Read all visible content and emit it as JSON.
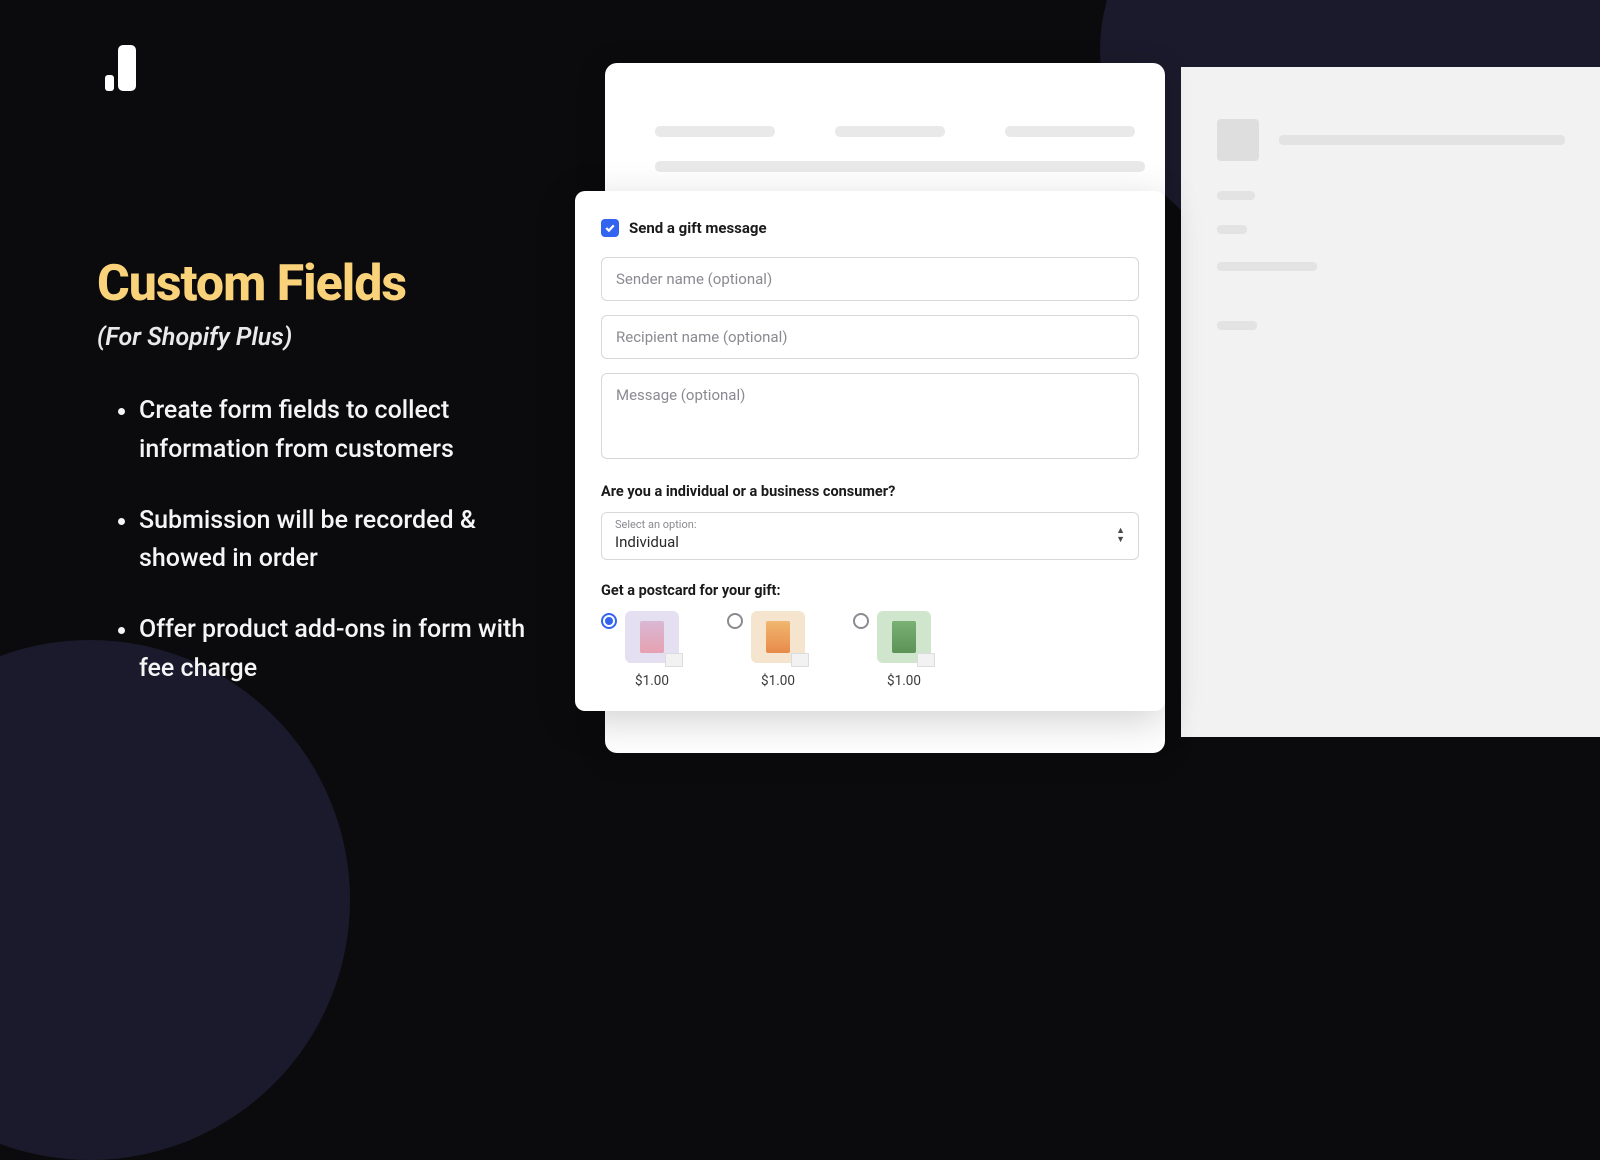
{
  "left": {
    "title": "Custom Fields",
    "subtitle": "(For Shopify Plus)",
    "bullets": [
      "Create form fields to collect information from customers",
      "Submission will be recorded & showed in order",
      "Offer product add-ons in form with fee charge"
    ]
  },
  "form": {
    "checkbox_label": "Send a gift message",
    "sender_placeholder": "Sender name (optional)",
    "recipient_placeholder": "Recipient name (optional)",
    "message_placeholder": "Message (optional)",
    "consumer_question": "Are you a individual or a business consumer?",
    "select_caption": "Select an option:",
    "select_value": "Individual",
    "postcard_label": "Get a postcard for your gift:",
    "postcards": [
      {
        "price": "$1.00"
      },
      {
        "price": "$1.00"
      },
      {
        "price": "$1.00"
      }
    ]
  }
}
